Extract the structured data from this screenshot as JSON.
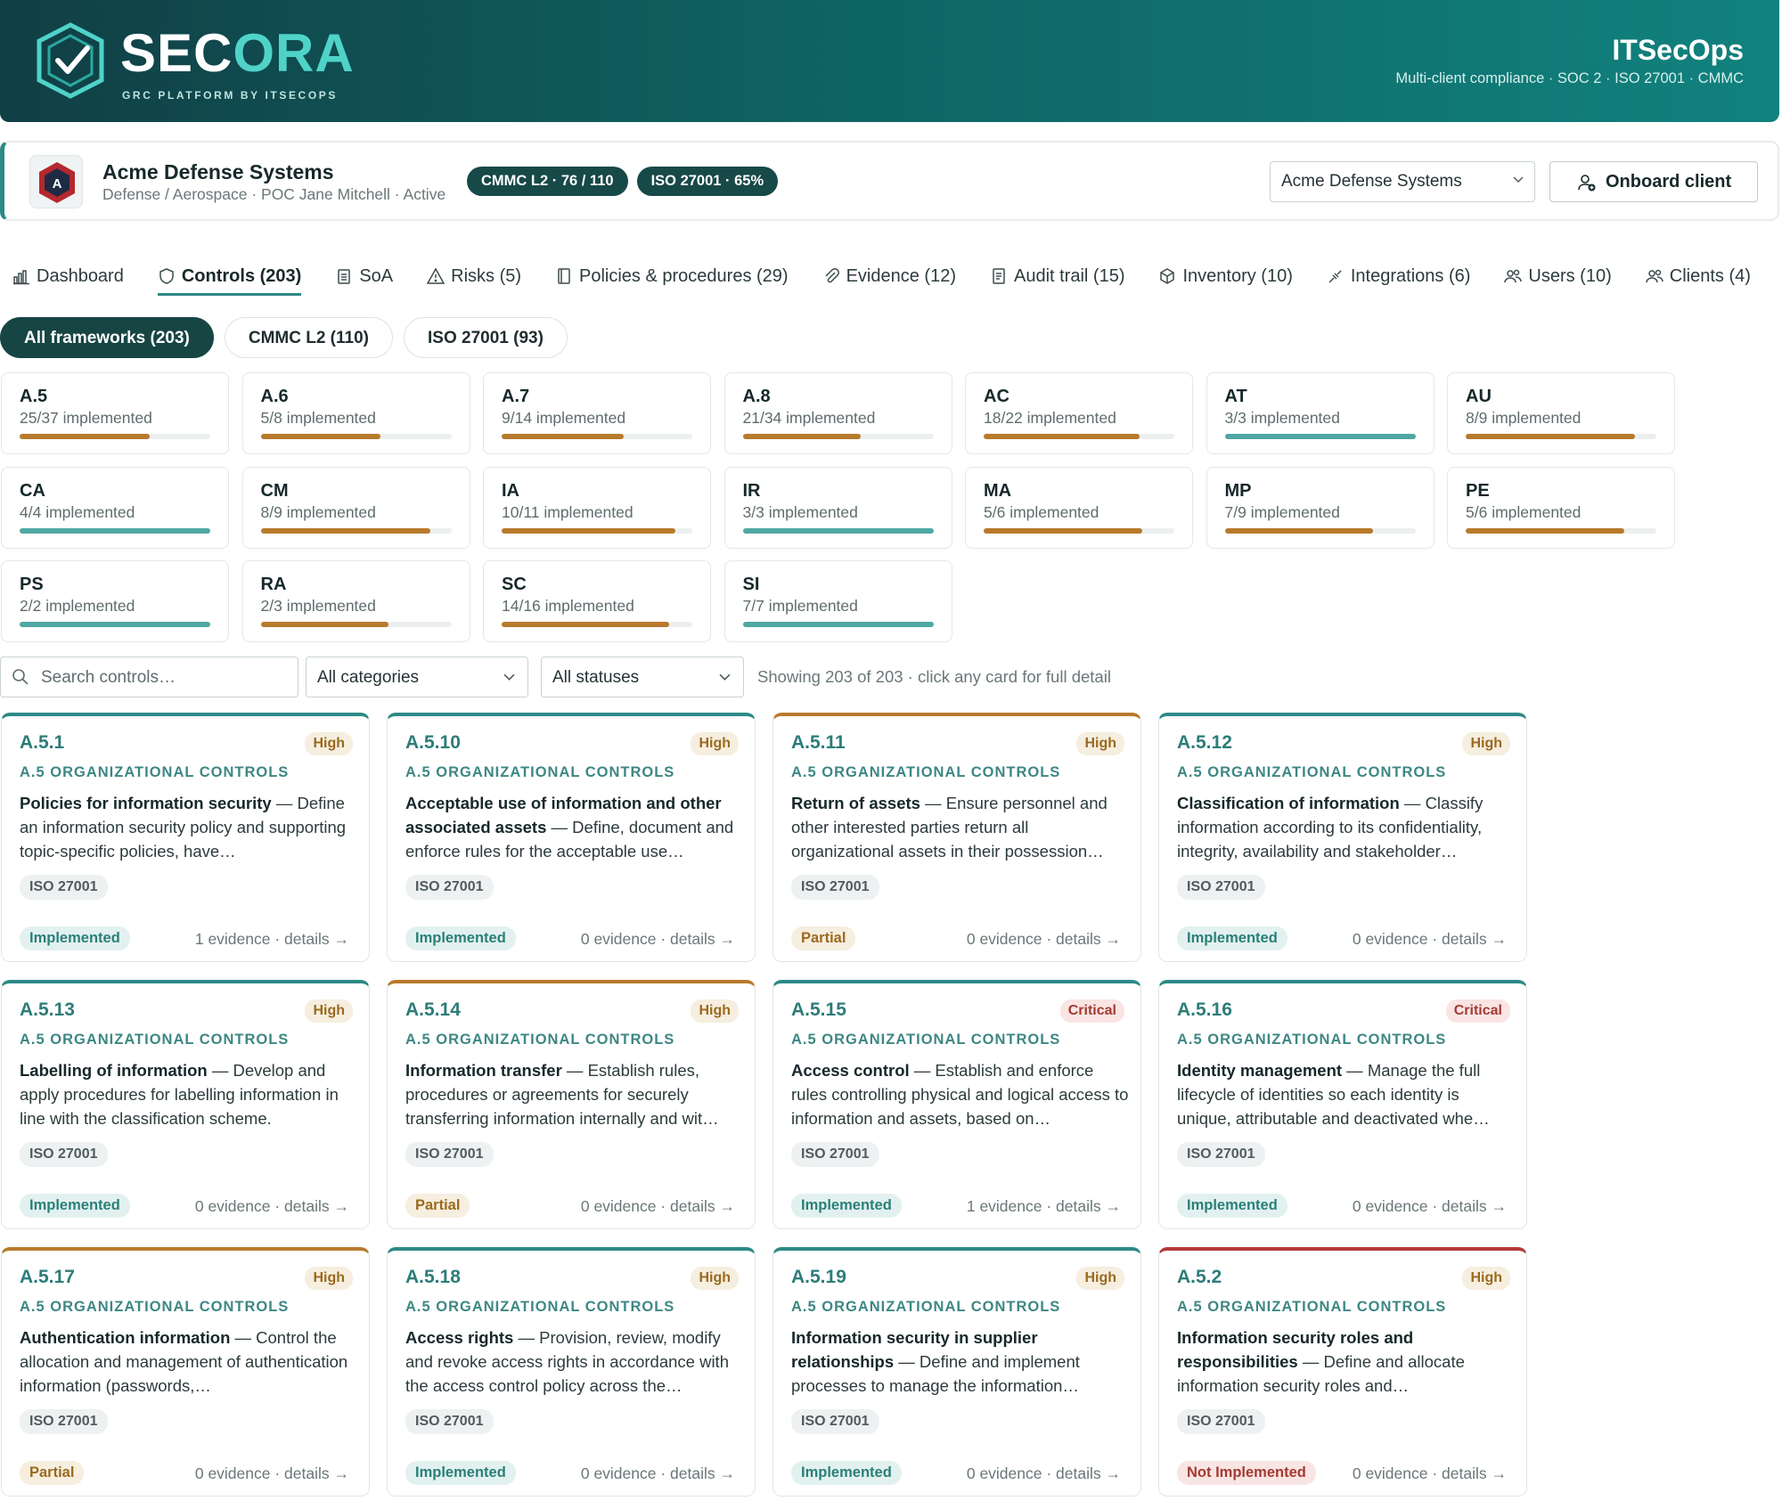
{
  "header": {
    "brand_left": "SEC",
    "brand_right": "ORA",
    "brand_sub": "GRC PLATFORM BY ITSECOPS",
    "org": "ITSecOps",
    "org_sub": "Multi-client compliance · SOC 2 · ISO 27001 · CMMC"
  },
  "client": {
    "name": "Acme Defense Systems",
    "meta": "Defense / Aerospace · POC Jane Mitchell · Active",
    "badges": [
      "CMMC L2 · 76 / 110",
      "ISO 27001 · 65%"
    ],
    "select_value": "Acme Defense Systems",
    "onboard_label": "Onboard client"
  },
  "tabs": [
    {
      "label": "Dashboard",
      "icon": "chart-icon"
    },
    {
      "label": "Controls (203)",
      "icon": "shield-icon",
      "active": true
    },
    {
      "label": "SoA",
      "icon": "clipboard-icon"
    },
    {
      "label": "Risks (5)",
      "icon": "warning-icon"
    },
    {
      "label": "Policies & procedures (29)",
      "icon": "book-icon"
    },
    {
      "label": "Evidence (12)",
      "icon": "paperclip-icon"
    },
    {
      "label": "Audit trail (15)",
      "icon": "document-icon"
    },
    {
      "label": "Inventory (10)",
      "icon": "box-icon"
    },
    {
      "label": "Integrations (6)",
      "icon": "plug-icon"
    },
    {
      "label": "Users (10)",
      "icon": "users-icon"
    },
    {
      "label": "Clients (4)",
      "icon": "users-icon"
    }
  ],
  "pills": [
    "All frameworks (203)",
    "CMMC L2 (110)",
    "ISO 27001 (93)"
  ],
  "domains": [
    {
      "code": "A.5",
      "text": "25/37 implemented",
      "pct": 0.68,
      "color": "#b87a2c"
    },
    {
      "code": "A.6",
      "text": "5/8 implemented",
      "pct": 0.63,
      "color": "#b87a2c"
    },
    {
      "code": "A.7",
      "text": "9/14 implemented",
      "pct": 0.64,
      "color": "#b87a2c"
    },
    {
      "code": "A.8",
      "text": "21/34 implemented",
      "pct": 0.62,
      "color": "#b87a2c"
    },
    {
      "code": "AC",
      "text": "18/22 implemented",
      "pct": 0.82,
      "color": "#b87a2c"
    },
    {
      "code": "AT",
      "text": "3/3 implemented",
      "pct": 1.0,
      "color": "#4fa8a3"
    },
    {
      "code": "AU",
      "text": "8/9 implemented",
      "pct": 0.89,
      "color": "#b87a2c"
    },
    {
      "code": "CA",
      "text": "4/4 implemented",
      "pct": 1.0,
      "color": "#4fa8a3"
    },
    {
      "code": "CM",
      "text": "8/9 implemented",
      "pct": 0.89,
      "color": "#b87a2c"
    },
    {
      "code": "IA",
      "text": "10/11 implemented",
      "pct": 0.91,
      "color": "#b87a2c"
    },
    {
      "code": "IR",
      "text": "3/3 implemented",
      "pct": 1.0,
      "color": "#4fa8a3"
    },
    {
      "code": "MA",
      "text": "5/6 implemented",
      "pct": 0.83,
      "color": "#b87a2c"
    },
    {
      "code": "MP",
      "text": "7/9 implemented",
      "pct": 0.78,
      "color": "#b87a2c"
    },
    {
      "code": "PE",
      "text": "5/6 implemented",
      "pct": 0.83,
      "color": "#b87a2c"
    },
    {
      "code": "PS",
      "text": "2/2 implemented",
      "pct": 1.0,
      "color": "#4fa8a3"
    },
    {
      "code": "RA",
      "text": "2/3 implemented",
      "pct": 0.67,
      "color": "#b87a2c"
    },
    {
      "code": "SC",
      "text": "14/16 implemented",
      "pct": 0.88,
      "color": "#b87a2c"
    },
    {
      "code": "SI",
      "text": "7/7 implemented",
      "pct": 1.0,
      "color": "#4fa8a3"
    }
  ],
  "filters": {
    "search_placeholder": "Search controls…",
    "category": "All categories",
    "status": "All statuses",
    "showing": "Showing 203 of 203 · click any card for full detail"
  },
  "controls": [
    {
      "id": "A.5.1",
      "severity": "High",
      "category": "A.5 ORGANIZATIONAL CONTROLS",
      "title": "Policies for information security",
      "desc": "Define an information security policy and supporting topic-specific policies, have…",
      "framework": "ISO 27001",
      "status": "Implemented",
      "evidence": "1 evidence · details →",
      "accent": "#2c8a86"
    },
    {
      "id": "A.5.10",
      "severity": "High",
      "category": "A.5 ORGANIZATIONAL CONTROLS",
      "title": "Acceptable use of information and other associated assets",
      "desc": "Define, document and enforce rules for the acceptable use…",
      "framework": "ISO 27001",
      "status": "Implemented",
      "evidence": "0 evidence · details →",
      "accent": "#2c8a86"
    },
    {
      "id": "A.5.11",
      "severity": "High",
      "category": "A.5 ORGANIZATIONAL CONTROLS",
      "title": "Return of assets",
      "desc": "Ensure personnel and other interested parties return all organizational assets in their possession…",
      "framework": "ISO 27001",
      "status": "Partial",
      "evidence": "0 evidence · details →",
      "accent": "#b87a2c"
    },
    {
      "id": "A.5.12",
      "severity": "High",
      "category": "A.5 ORGANIZATIONAL CONTROLS",
      "title": "Classification of information",
      "desc": "Classify information according to its confidentiality, integrity, availability and stakeholder…",
      "framework": "ISO 27001",
      "status": "Implemented",
      "evidence": "0 evidence · details →",
      "accent": "#2c8a86"
    },
    {
      "id": "A.5.13",
      "severity": "High",
      "category": "A.5 ORGANIZATIONAL CONTROLS",
      "title": "Labelling of information",
      "desc": "Develop and apply procedures for labelling information in line with the classification scheme.",
      "framework": "ISO 27001",
      "status": "Implemented",
      "evidence": "0 evidence · details →",
      "accent": "#2c8a86"
    },
    {
      "id": "A.5.14",
      "severity": "High",
      "category": "A.5 ORGANIZATIONAL CONTROLS",
      "title": "Information transfer",
      "desc": "Establish rules, procedures or agreements for securely transferring information internally and wit…",
      "framework": "ISO 27001",
      "status": "Partial",
      "evidence": "0 evidence · details →",
      "accent": "#b87a2c"
    },
    {
      "id": "A.5.15",
      "severity": "Critical",
      "category": "A.5 ORGANIZATIONAL CONTROLS",
      "title": "Access control",
      "desc": "Establish and enforce rules controlling physical and logical access to information and assets, based on…",
      "framework": "ISO 27001",
      "status": "Implemented",
      "evidence": "1 evidence · details →",
      "accent": "#2c8a86"
    },
    {
      "id": "A.5.16",
      "severity": "Critical",
      "category": "A.5 ORGANIZATIONAL CONTROLS",
      "title": "Identity management",
      "desc": "Manage the full lifecycle of identities so each identity is unique, attributable and deactivated whe…",
      "framework": "ISO 27001",
      "status": "Implemented",
      "evidence": "0 evidence · details →",
      "accent": "#2c8a86"
    },
    {
      "id": "A.5.17",
      "severity": "High",
      "category": "A.5 ORGANIZATIONAL CONTROLS",
      "title": "Authentication information",
      "desc": "Control the allocation and management of authentication information (passwords,…",
      "framework": "ISO 27001",
      "status": "Partial",
      "evidence": "0 evidence · details →",
      "accent": "#b87a2c"
    },
    {
      "id": "A.5.18",
      "severity": "High",
      "category": "A.5 ORGANIZATIONAL CONTROLS",
      "title": "Access rights",
      "desc": "Provision, review, modify and revoke access rights in accordance with the access control policy across the…",
      "framework": "ISO 27001",
      "status": "Implemented",
      "evidence": "0 evidence · details →",
      "accent": "#2c8a86"
    },
    {
      "id": "A.5.19",
      "severity": "High",
      "category": "A.5 ORGANIZATIONAL CONTROLS",
      "title": "Information security in supplier relationships",
      "desc": "Define and implement processes to manage the information…",
      "framework": "ISO 27001",
      "status": "Implemented",
      "evidence": "0 evidence · details →",
      "accent": "#2c8a86"
    },
    {
      "id": "A.5.2",
      "severity": "High",
      "category": "A.5 ORGANIZATIONAL CONTROLS",
      "title": "Information security roles and responsibilities",
      "desc": "Define and allocate information security roles and…",
      "framework": "ISO 27001",
      "status": "Not Implemented",
      "evidence": "0 evidence · details →",
      "accent": "#b33a3a"
    }
  ]
}
